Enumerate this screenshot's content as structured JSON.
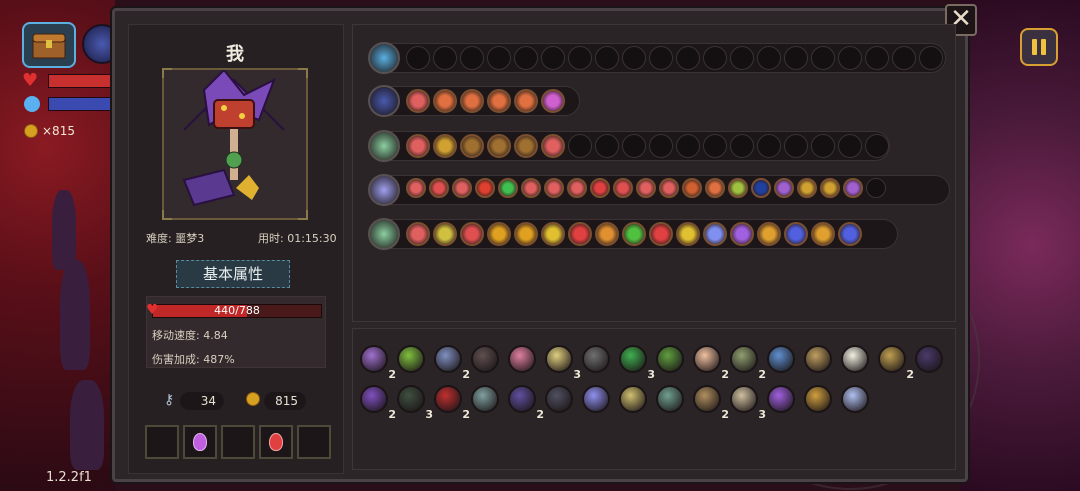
{
  "hud": {
    "coin_count": "×815",
    "version": "1.2.2f1"
  },
  "character": {
    "name": "我",
    "difficulty": "难度: 噩梦3",
    "time": "用时: 01:15:30",
    "section_title": "基本属性",
    "hp_text": "440/788",
    "hp_fraction": 0.558,
    "move_speed": "移动速度: 4.84",
    "damage_bonus": "伤害加成: 487%",
    "keys": "34",
    "coins": "815",
    "slots": [
      {
        "potion": false,
        "color": ""
      },
      {
        "potion": true,
        "color": "#c060e0"
      },
      {
        "potion": false,
        "color": ""
      },
      {
        "potion": true,
        "color": "#e04040"
      },
      {
        "potion": false,
        "color": ""
      }
    ]
  },
  "rows": [
    {
      "icon": "chest-icon",
      "icon_color": "#5ab0e0",
      "filled": [],
      "total": 20
    },
    {
      "icon": "orb-icon",
      "icon_color": "#4a5ab0",
      "filled": [
        "#e06060",
        "#e07040",
        "#e07040",
        "#e07040",
        "#e07040",
        "#d060d0"
      ],
      "total": 6
    },
    {
      "icon": "staff-icon",
      "icon_color": "#8ad0a0",
      "filled": [
        "#e06060",
        "#d0a030",
        "#a07030",
        "#a07030",
        "#a07030",
        "#e06060"
      ],
      "total": 18
    },
    {
      "icon": "wand-icon",
      "icon_color": "#a0a0f0",
      "filled": [
        "#e06060",
        "#e05050",
        "#e06060",
        "#e04030",
        "#40c050",
        "#e06060",
        "#e06060",
        "#e06060",
        "#e04040",
        "#e05050",
        "#e06060",
        "#e06060",
        "#d06030",
        "#e07040",
        "#a0c040",
        "#2040a0",
        "#a060d0",
        "#d0a030",
        "#d0a030",
        "#a060d0"
      ],
      "total": 21
    },
    {
      "icon": "spear-icon",
      "icon_color": "#8ad0a0",
      "filled": [
        "#e06060",
        "#d0c040",
        "#e05050",
        "#e0a020",
        "#e0a020",
        "#e0c030",
        "#e04040",
        "#e09030",
        "#50c040",
        "#e04040",
        "#e0c030",
        "#8090f0",
        "#a060e0",
        "#e0a030",
        "#5060e0",
        "#e0a030",
        "#5060e0"
      ],
      "total": 17
    }
  ],
  "inventory": [
    {
      "color": "#a070d0",
      "count": "2"
    },
    {
      "color": "#80c040",
      "count": ""
    },
    {
      "color": "#8090c0",
      "count": "2"
    },
    {
      "color": "#605050",
      "count": ""
    },
    {
      "color": "#e080a0",
      "count": ""
    },
    {
      "color": "#e0d080",
      "count": "3"
    },
    {
      "color": "#707070",
      "count": ""
    },
    {
      "color": "#40b050",
      "count": "3"
    },
    {
      "color": "#60a040",
      "count": ""
    },
    {
      "color": "#f0c0a0",
      "count": "2"
    },
    {
      "color": "#90a070",
      "count": "2"
    },
    {
      "color": "#6090d0",
      "count": ""
    },
    {
      "color": "#c0a060",
      "count": ""
    },
    {
      "color": "#f0f0e0",
      "count": ""
    },
    {
      "color": "#c0a050",
      "count": "2"
    },
    {
      "color": "#4a3a6a",
      "count": ""
    },
    {
      "color": "#8050c0",
      "count": "2"
    },
    {
      "color": "#405040",
      "count": "3"
    },
    {
      "color": "#c03030",
      "count": "2"
    },
    {
      "color": "#80a0a0",
      "count": ""
    },
    {
      "color": "#6050a0",
      "count": "2"
    },
    {
      "color": "#505060",
      "count": ""
    },
    {
      "color": "#9090f0",
      "count": ""
    },
    {
      "color": "#d0c070",
      "count": ""
    },
    {
      "color": "#70a090",
      "count": ""
    },
    {
      "color": "#b09060",
      "count": "2"
    },
    {
      "color": "#d0c0a0",
      "count": "3"
    },
    {
      "color": "#a060e0",
      "count": ""
    },
    {
      "color": "#d0a040",
      "count": ""
    },
    {
      "color": "#b0c0f0",
      "count": ""
    }
  ],
  "colors": {
    "panel_bg": "#2c2628",
    "hp_red": "#c02828",
    "accent_gold": "#d8a030"
  }
}
